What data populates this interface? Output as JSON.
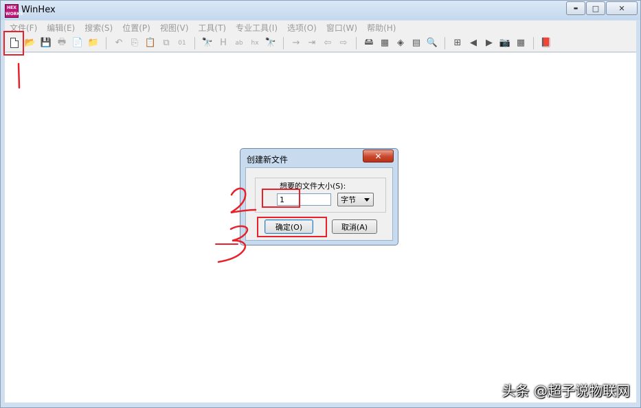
{
  "window": {
    "title": "WinHex",
    "app_icon_text_top": "HEX",
    "app_icon_text_bottom": "WORKS",
    "minimize_glyph": "▬",
    "maximize_glyph": "□",
    "close_glyph": "✕"
  },
  "menu": {
    "items": [
      {
        "label": "文件(F)"
      },
      {
        "label": "编辑(E)"
      },
      {
        "label": "搜索(S)"
      },
      {
        "label": "位置(P)"
      },
      {
        "label": "视图(V)"
      },
      {
        "label": "工具(T)"
      },
      {
        "label": "专业工具(I)"
      },
      {
        "label": "选项(O)"
      },
      {
        "label": "窗口(W)"
      },
      {
        "label": "帮助(H)"
      }
    ]
  },
  "toolbar": {
    "icons": [
      {
        "name": "new-file-icon",
        "glyph": ""
      },
      {
        "name": "open-folder-icon",
        "glyph": "📂"
      },
      {
        "name": "save-icon",
        "glyph": "💾"
      },
      {
        "name": "print-icon",
        "glyph": "🖶"
      },
      {
        "name": "properties-icon",
        "glyph": "📄"
      },
      {
        "name": "open-folder-2-icon",
        "glyph": "📁"
      },
      {
        "name": "undo-icon",
        "glyph": "↶"
      },
      {
        "name": "copy-icon",
        "glyph": "⎘"
      },
      {
        "name": "paste-icon",
        "glyph": "📋"
      },
      {
        "name": "paste-special-icon",
        "glyph": "⧉"
      },
      {
        "name": "binary-icon",
        "glyph": "01"
      },
      {
        "name": "find-icon",
        "glyph": "🔭"
      },
      {
        "name": "find-hex-icon",
        "glyph": "H"
      },
      {
        "name": "replace-text-icon",
        "glyph": "ab"
      },
      {
        "name": "replace-hex-icon",
        "glyph": "hx"
      },
      {
        "name": "find-again-icon",
        "glyph": "🔭"
      },
      {
        "name": "goto-offset-icon",
        "glyph": "→"
      },
      {
        "name": "goto-marker-icon",
        "glyph": "⇥"
      },
      {
        "name": "back-icon",
        "glyph": "⇦"
      },
      {
        "name": "forward-icon",
        "glyph": "⇨"
      },
      {
        "name": "disk-edit-icon",
        "glyph": "🖴"
      },
      {
        "name": "ram-edit-icon",
        "glyph": "▦"
      },
      {
        "name": "disk-image-icon",
        "glyph": "◈"
      },
      {
        "name": "calculator-icon",
        "glyph": "▤"
      },
      {
        "name": "zoom-icon",
        "glyph": "🔍"
      },
      {
        "name": "scan-icon",
        "glyph": "⊞"
      },
      {
        "name": "prev-icon",
        "glyph": "◀"
      },
      {
        "name": "next-icon",
        "glyph": "▶"
      },
      {
        "name": "camera-icon",
        "glyph": "📷"
      },
      {
        "name": "table-icon",
        "glyph": "▦"
      },
      {
        "name": "help-book-icon",
        "glyph": "📕"
      }
    ]
  },
  "dialog": {
    "title": "创建新文件",
    "close_glyph": "✕",
    "group_label": "想要的文件大小(S):",
    "size_value": "1",
    "unit_value": "字节",
    "ok_label": "确定(O)",
    "cancel_label": "取消(A)"
  },
  "annotations": {
    "marks": [
      "1",
      "2",
      "3"
    ],
    "color": "#e8202a"
  },
  "watermark": "头条 @超子说物联网"
}
